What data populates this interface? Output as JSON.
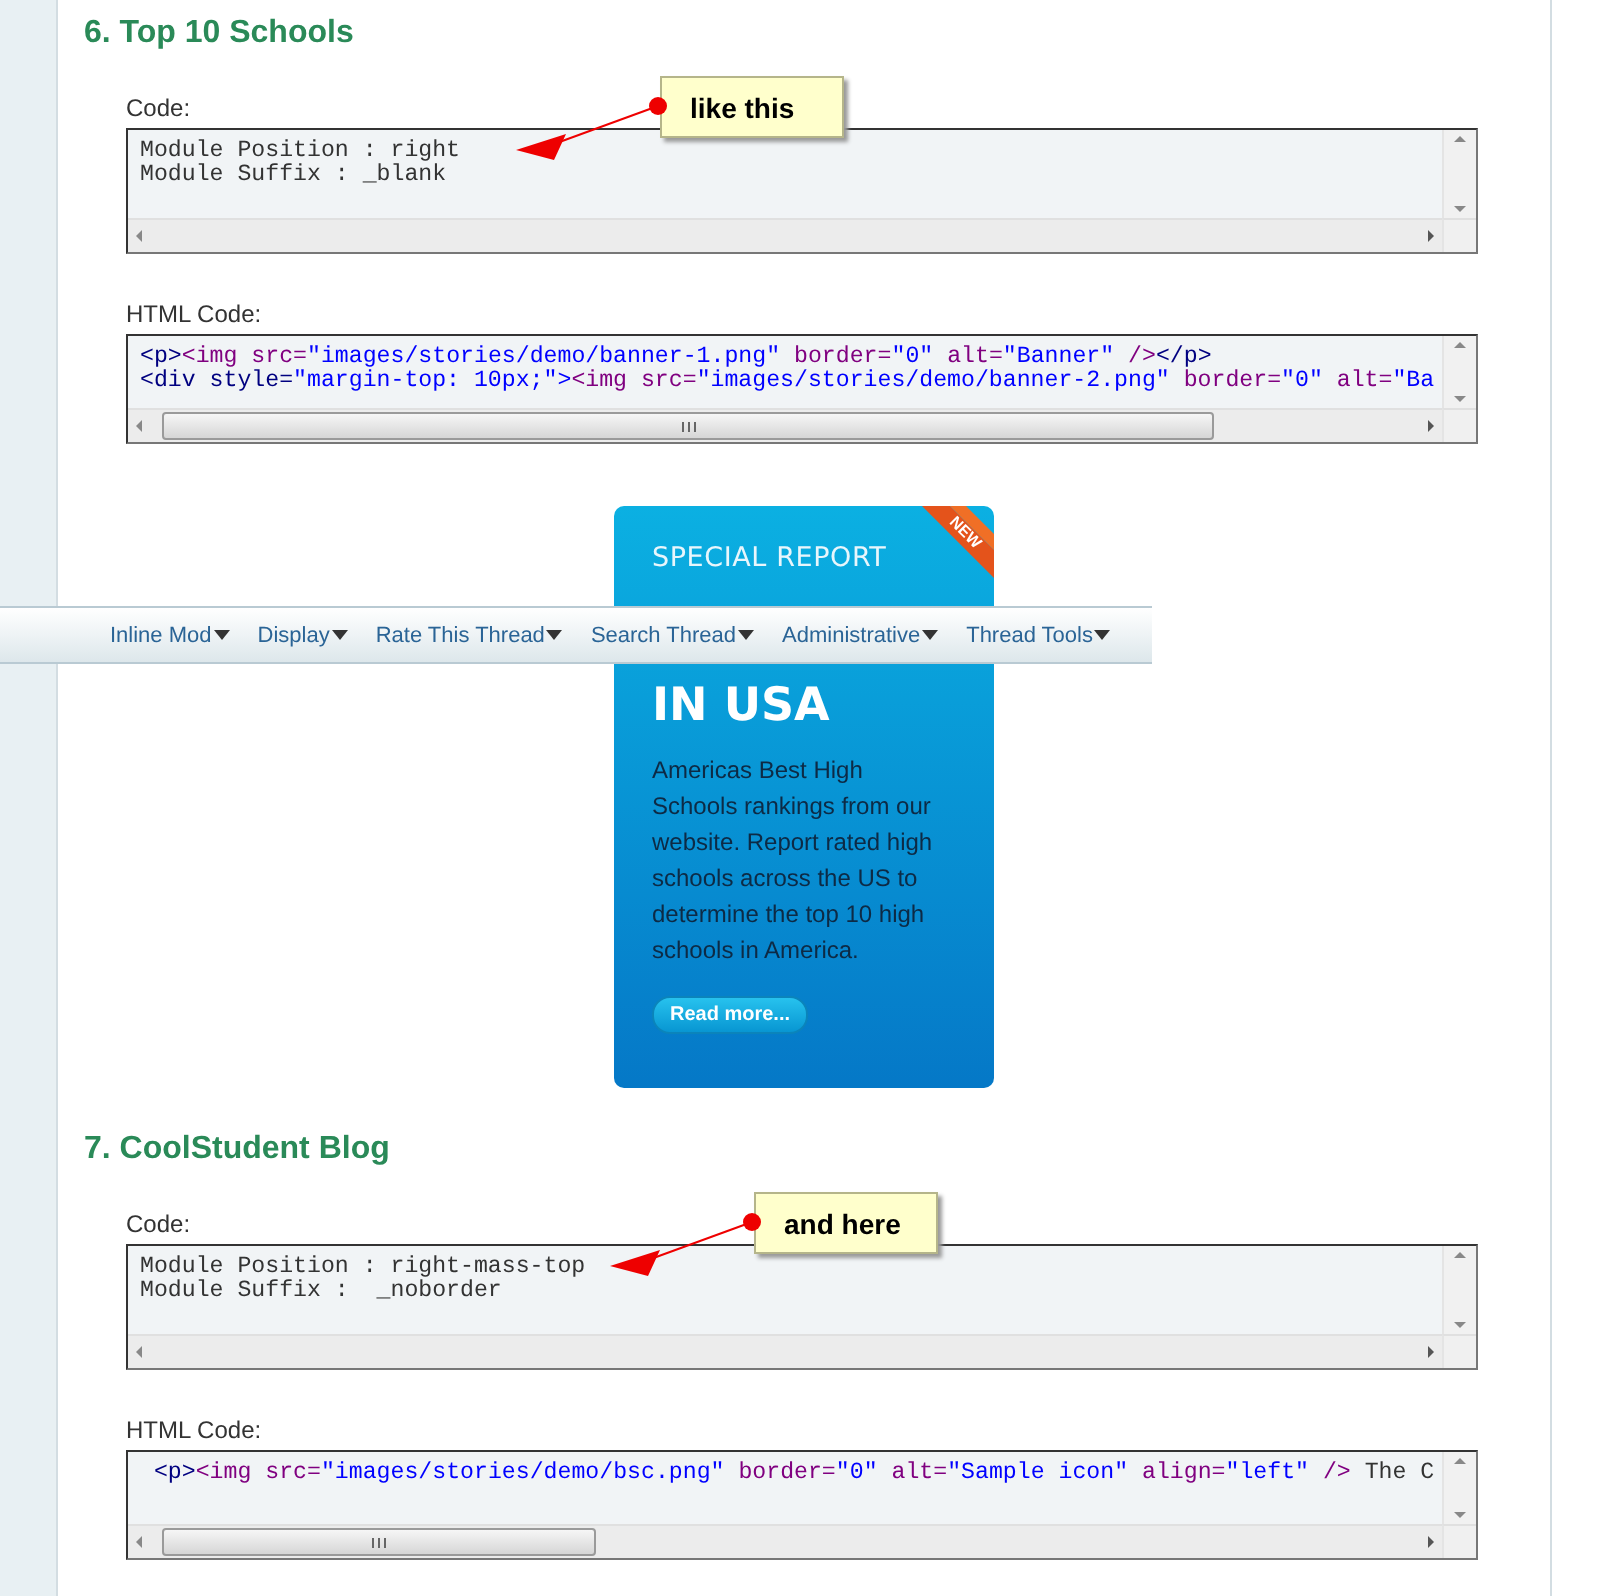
{
  "sections": [
    {
      "heading": "6. Top 10 Schools",
      "callout": "like this",
      "boxes": [
        {
          "kind": "code",
          "label": "Code:",
          "lines": [
            [
              {
                "kind": "plain",
                "text": "Module Position : right"
              }
            ],
            [
              {
                "kind": "plain",
                "text": "Module Suffix : _blank"
              }
            ]
          ]
        },
        {
          "kind": "html",
          "label": "HTML Code:",
          "lines": [
            [
              {
                "kind": "tag",
                "text": "<p>"
              },
              {
                "kind": "element",
                "text": "<img src="
              },
              {
                "kind": "value",
                "text": "\"images/stories/demo/banner-1.png\""
              },
              {
                "kind": "element",
                "text": " border="
              },
              {
                "kind": "value",
                "text": "\"0\""
              },
              {
                "kind": "element",
                "text": " alt="
              },
              {
                "kind": "value",
                "text": "\"Banner\""
              },
              {
                "kind": "element",
                "text": " />"
              },
              {
                "kind": "tag",
                "text": "</p>"
              }
            ],
            [
              {
                "kind": "tag",
                "text": "<div style="
              },
              {
                "kind": "value",
                "text": "\"margin-top: 10px;\">"
              },
              {
                "kind": "element",
                "text": "<img src="
              },
              {
                "kind": "value",
                "text": "\"images/stories/demo/banner-2.png\""
              },
              {
                "kind": "element",
                "text": " border="
              },
              {
                "kind": "value",
                "text": "\"0\""
              },
              {
                "kind": "element",
                "text": " alt="
              },
              {
                "kind": "value",
                "text": "\"Ba"
              }
            ]
          ]
        }
      ],
      "banner": {
        "kicker": "SPECIAL REPORT",
        "ribbon": "NEW",
        "title": "IN USA",
        "body": "Americas Best High Schools rankings from our website. Report rated high schools across the US to determine the top 10 high schools in America.",
        "button": "Read more..."
      }
    },
    {
      "heading": "7. CoolStudent Blog",
      "callout": "and here",
      "boxes": [
        {
          "kind": "code",
          "label": "Code:",
          "lines": [
            [
              {
                "kind": "plain",
                "text": "Module Position : right-mass-top"
              }
            ],
            [
              {
                "kind": "plain",
                "text": "Module Suffix :  _noborder"
              }
            ]
          ]
        },
        {
          "kind": "html",
          "label": "HTML Code:",
          "lines": [
            [
              {
                "kind": "tag",
                "text": " <p>"
              },
              {
                "kind": "element",
                "text": "<img src="
              },
              {
                "kind": "value",
                "text": "\"images/stories/demo/bsc.png\""
              },
              {
                "kind": "element",
                "text": " border="
              },
              {
                "kind": "value",
                "text": "\"0\""
              },
              {
                "kind": "element",
                "text": " alt="
              },
              {
                "kind": "value",
                "text": "\"Sample icon\""
              },
              {
                "kind": "element",
                "text": " align="
              },
              {
                "kind": "value",
                "text": "\"left\""
              },
              {
                "kind": "element",
                "text": " />"
              },
              {
                "kind": "plain",
                "text": " The C"
              }
            ]
          ]
        }
      ]
    }
  ],
  "toolbar": {
    "items": [
      "Inline Mod",
      "Display",
      "Rate This Thread",
      "Search Thread",
      "Administrative",
      "Thread Tools"
    ]
  }
}
